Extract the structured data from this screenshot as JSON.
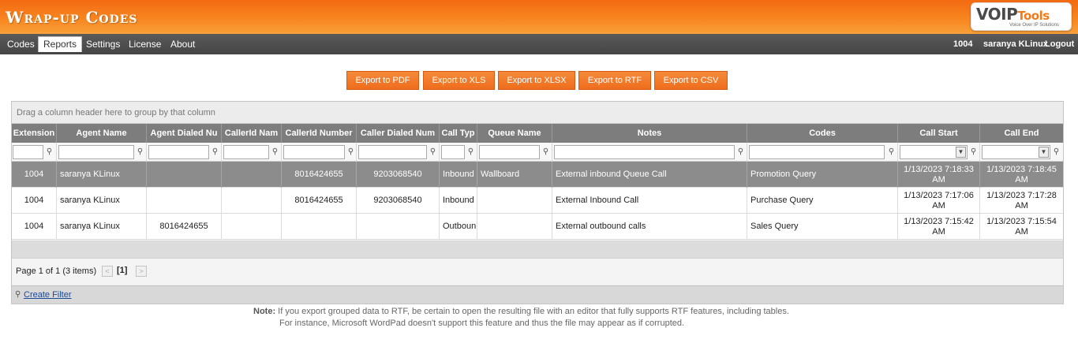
{
  "app": {
    "title": "Wrap-up Codes",
    "logo": {
      "main_a": "VOIP",
      "main_b": "Tools",
      "sub": "Voice Over IP Solutions"
    }
  },
  "nav": {
    "items": [
      {
        "label": "Codes",
        "active": false
      },
      {
        "label": "Reports",
        "active": true
      },
      {
        "label": "Settings",
        "active": false
      },
      {
        "label": "License",
        "active": false
      },
      {
        "label": "About",
        "active": false
      }
    ],
    "extension": "1004",
    "user": "saranya KLinux",
    "logout": "Logout"
  },
  "export_buttons": [
    "Export to PDF",
    "Export to XLS",
    "Export to XLSX",
    "Export to RTF",
    "Export to CSV"
  ],
  "grid": {
    "group_panel_text": "Drag a column header here to group by that column",
    "columns": [
      "Extension",
      "Agent Name",
      "Agent Dialed Nu",
      "CallerId Nam",
      "CallerId Number",
      "Caller Dialed Num",
      "Call Typ",
      "Queue Name",
      "Notes",
      "Codes",
      "Call Start",
      "Call End"
    ],
    "rows": [
      {
        "selected": true,
        "cells": [
          "1004",
          "saranya KLinux",
          "",
          "",
          "8016424655",
          "9203068540",
          "Inbound",
          "Wallboard",
          "External inbound Queue Call",
          "Promotion Query",
          "1/13/2023 7:18:33 AM",
          "1/13/2023 7:18:45 AM"
        ]
      },
      {
        "selected": false,
        "cells": [
          "1004",
          "saranya KLinux",
          "",
          "",
          "8016424655",
          "9203068540",
          "Inbound",
          "",
          "External Inbound Call",
          "Purchase Query",
          "1/13/2023 7:17:06 AM",
          "1/13/2023 7:17:28 AM"
        ]
      },
      {
        "selected": false,
        "cells": [
          "1004",
          "saranya KLinux",
          "8016424655",
          "",
          "",
          "",
          "Outboun",
          "",
          "External outbound calls",
          "Sales Query",
          "1/13/2023 7:15:42 AM",
          "1/13/2023 7:15:54 AM"
        ]
      }
    ],
    "pager": {
      "summary": "Page 1 of 1 (3 items)",
      "current": "[1]",
      "prev": "<",
      "next": ">"
    },
    "create_filter": "Create Filter"
  },
  "note": {
    "label": "Note:",
    "line1": "If you export grouped data to RTF, be certain to open the resulting file with an editor that fully supports RTF features, including tables.",
    "line2": "For instance, Microsoft WordPad doesn't support this feature and thus the file may appear as if corrupted."
  },
  "colors": {
    "header_orange": "#f36a12",
    "nav_gray": "#4e4e4e",
    "grid_header": "#7d7d7d",
    "button_orange": "#ee6d1c",
    "selected_row": "#8c8c8c"
  }
}
